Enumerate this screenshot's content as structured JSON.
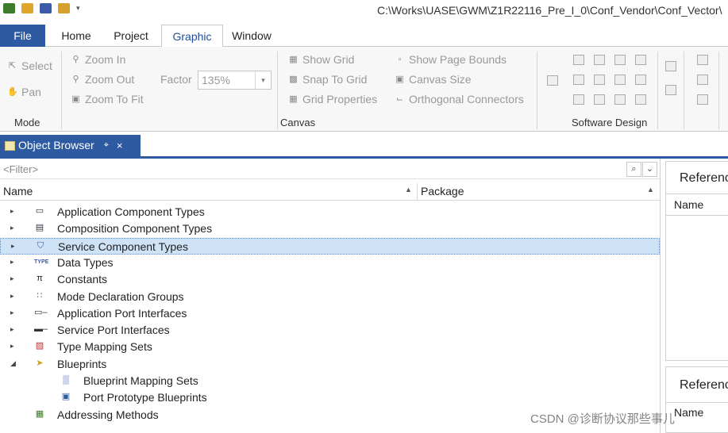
{
  "window": {
    "path": "C:\\Works\\UASE\\GWM\\Z1R22116_Pre_I_0\\Conf_Vendor\\Conf_Vector\\"
  },
  "ribbon_tabs": [
    "File",
    "Home",
    "Project",
    "Graphic",
    "Window"
  ],
  "active_tab": "Graphic",
  "ribbon": {
    "mode": {
      "select": "Select",
      "pan": "Pan",
      "group_label": "Mode"
    },
    "zoom": {
      "zoom_in": "Zoom In",
      "zoom_out": "Zoom Out",
      "zoom_to_fit": "Zoom To Fit",
      "factor_label": "Factor",
      "factor_value": "135%"
    },
    "canvas": {
      "show_grid": "Show Grid",
      "snap_to_grid": "Snap To Grid",
      "grid_properties": "Grid Properties",
      "show_page_bounds": "Show Page Bounds",
      "canvas_size": "Canvas Size",
      "orthogonal_connectors": "Orthogonal Connectors",
      "group_label": "Canvas"
    },
    "software_design": {
      "group_label": "Software Design"
    }
  },
  "object_browser": {
    "tab_title": "Object Browser",
    "pin_glyph": "⌖",
    "close_glyph": "×",
    "filter_placeholder": "<Filter>",
    "columns": {
      "name": "Name",
      "package": "Package"
    },
    "items": [
      {
        "label": "Application Component Types",
        "expanded": false,
        "indent": 0,
        "icon": "application-component-icon",
        "glyph": "▭",
        "color": "#334"
      },
      {
        "label": "Composition Component Types",
        "expanded": false,
        "indent": 0,
        "icon": "composition-component-icon",
        "glyph": "▤",
        "color": "#334"
      },
      {
        "label": "Service Component Types",
        "expanded": false,
        "indent": 0,
        "icon": "service-component-icon",
        "glyph": "⛉",
        "color": "#3a5aa8",
        "selected": true
      },
      {
        "label": "Data Types",
        "expanded": false,
        "indent": 0,
        "icon": "data-type-icon",
        "glyph": "TYPE",
        "color": "#3a5aa8"
      },
      {
        "label": "Constants",
        "expanded": false,
        "indent": 0,
        "icon": "constant-pi-icon",
        "glyph": "π",
        "color": "#222"
      },
      {
        "label": "Mode Declaration Groups",
        "expanded": false,
        "indent": 0,
        "icon": "mode-declaration-icon",
        "glyph": "∷",
        "color": "#555"
      },
      {
        "label": "Application Port Interfaces",
        "expanded": false,
        "indent": 0,
        "icon": "application-port-interface-icon",
        "glyph": "▭–",
        "color": "#333"
      },
      {
        "label": "Service Port Interfaces",
        "expanded": false,
        "indent": 0,
        "icon": "service-port-interface-icon",
        "glyph": "▬–",
        "color": "#333"
      },
      {
        "label": "Type Mapping Sets",
        "expanded": false,
        "indent": 0,
        "icon": "type-mapping-icon",
        "glyph": "▨",
        "color": "#c02a2a"
      },
      {
        "label": "Blueprints",
        "expanded": true,
        "indent": 0,
        "icon": "blueprints-icon",
        "glyph": "➤",
        "color": "#d0a020"
      },
      {
        "label": "Blueprint Mapping Sets",
        "expanded": null,
        "indent": 1,
        "icon": "blueprint-mapping-icon",
        "glyph": "▒",
        "color": "#4060b0"
      },
      {
        "label": "Port Prototype Blueprints",
        "expanded": null,
        "indent": 1,
        "icon": "port-prototype-blueprint-icon",
        "glyph": "▣",
        "color": "#2d5aa0"
      },
      {
        "label": "Addressing Methods",
        "expanded": null,
        "indent": 0,
        "icon": "addressing-methods-icon",
        "glyph": "▦",
        "color": "#3b7d2a"
      }
    ]
  },
  "references_panel_top": {
    "title": "Referenc",
    "col_name": "Name"
  },
  "references_panel_bottom": {
    "title": "Referenc",
    "col_name": "Name"
  },
  "watermark": "CSDN @诊断协议那些事儿",
  "colors": {
    "accent": "#2d5aa0",
    "selection": "#cfe3f7"
  }
}
